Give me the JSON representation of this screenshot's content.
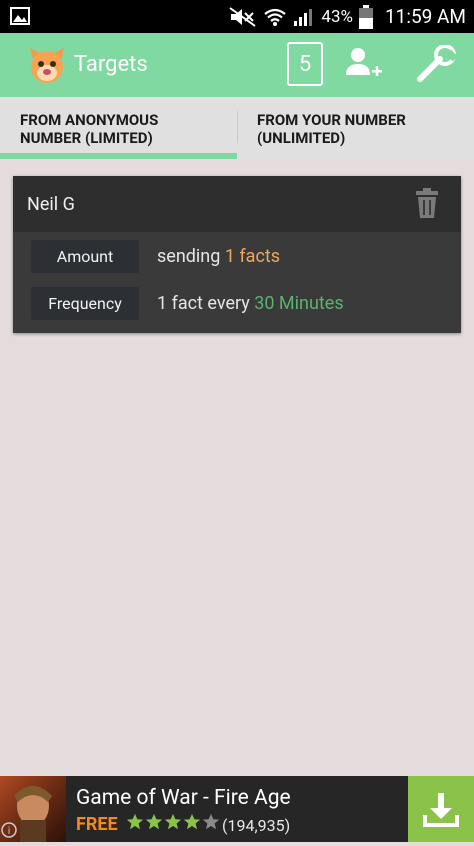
{
  "status_bar": {
    "battery_percent": "43%",
    "time": "11:59 AM"
  },
  "app_bar": {
    "title": "Targets",
    "count": "5"
  },
  "tabs": [
    {
      "label_line1": "FROM ANONYMOUS",
      "label_line2": "NUMBER (LIMITED)",
      "selected": true
    },
    {
      "label_line1": "FROM YOUR NUMBER",
      "label_line2": "(UNLIMITED)",
      "selected": false
    }
  ],
  "target": {
    "name": "Neil G",
    "amount_label": "Amount",
    "amount_text_prefix": "sending",
    "amount_value": "1 facts",
    "frequency_label": "Frequency",
    "frequency_text_prefix": "1 fact every",
    "frequency_value": "30 Minutes"
  },
  "ad": {
    "title": "Game of War - Fire Age",
    "price": "FREE",
    "rating_stars": 4,
    "rating_count": "(194,935)"
  },
  "colors": {
    "accent": "#80d9a0",
    "orange_value": "#f1a661",
    "green_value": "#5cb26f",
    "background": "#e4dcdc",
    "card_bg": "#3a3a3a"
  }
}
